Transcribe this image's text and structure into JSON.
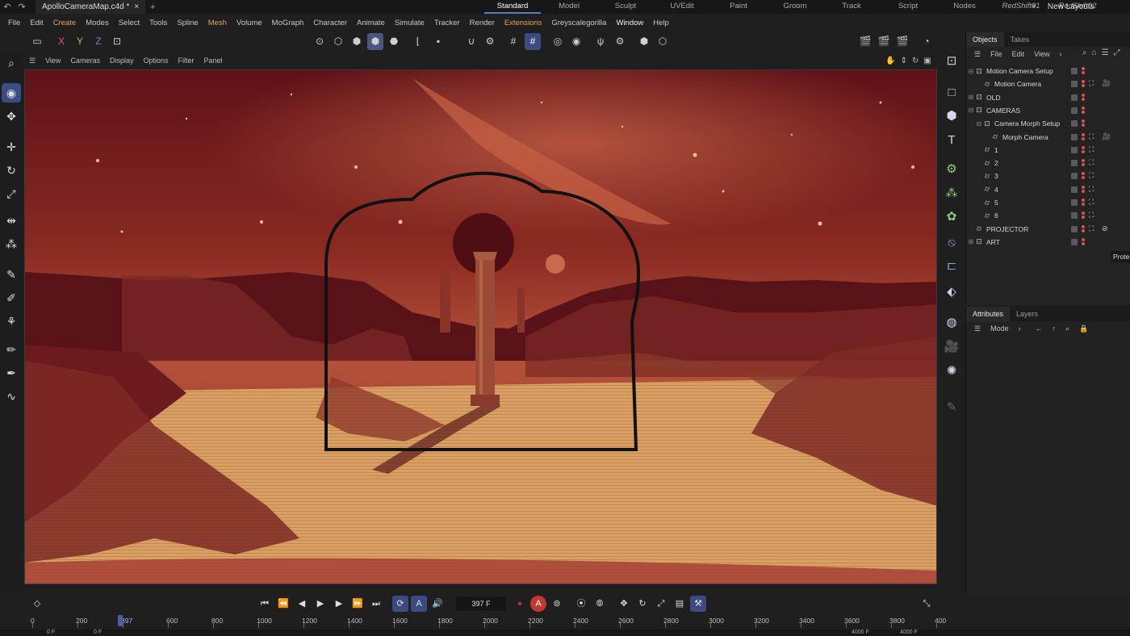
{
  "titlebar": {
    "undo_icon": "undo-icon",
    "redo_icon": "redo-icon",
    "doc_title": "ApolloCameraMap.c4d *",
    "add_tab": "+",
    "layouts": [
      {
        "label": "Standard",
        "active": true,
        "italic": false
      },
      {
        "label": "Model",
        "active": false,
        "italic": false
      },
      {
        "label": "Sculpt",
        "active": false,
        "italic": false
      },
      {
        "label": "UVEdit",
        "active": false,
        "italic": false
      },
      {
        "label": "Paint",
        "active": false,
        "italic": false
      },
      {
        "label": "Groom",
        "active": false,
        "italic": false
      },
      {
        "label": "Track",
        "active": false,
        "italic": false
      },
      {
        "label": "Script",
        "active": false,
        "italic": false
      },
      {
        "label": "Nodes",
        "active": false,
        "italic": false
      },
      {
        "label": "RedShift01",
        "active": false,
        "italic": true
      },
      {
        "label": "RedShift02",
        "active": false,
        "italic": true
      }
    ],
    "new_layout_plus": "+",
    "new_layouts": "New Layouts"
  },
  "menu": [
    "File",
    "Edit",
    "Create",
    "Modes",
    "Select",
    "Tools",
    "Spline",
    "Mesh",
    "Volume",
    "MoGraph",
    "Character",
    "Animate",
    "Simulate",
    "Tracker",
    "Render",
    "Extensions",
    "Greyscalegorilla",
    "Window",
    "Help"
  ],
  "menu_accent": [
    "Create",
    "Mesh",
    "Extensions"
  ],
  "toolbar": {
    "axis_x": "X",
    "axis_y": "Y",
    "axis_z": "Z",
    "colors": {
      "x": "#e0605a",
      "y": "#9ac95a",
      "z": "#5a8ae0"
    }
  },
  "viewport_menu": [
    "View",
    "Cameras",
    "Display",
    "Options",
    "Filter",
    "Panel"
  ],
  "objects_panel": {
    "tabs": [
      "Objects",
      "Takes"
    ],
    "menu": [
      "File",
      "Edit",
      "View"
    ],
    "rows": [
      {
        "label": "Motion Camera Setup",
        "indent": 0,
        "expander": "⊟",
        "icon": "null-icon",
        "tag": "",
        "tag2": ""
      },
      {
        "label": "Motion Camera",
        "indent": 1,
        "expander": "",
        "icon": "camera-icon",
        "tag": "⛶",
        "tag2": "🎥"
      },
      {
        "label": "OLD",
        "indent": 0,
        "expander": "⊞",
        "icon": "null-icon",
        "tag": "",
        "tag2": ""
      },
      {
        "label": "CAMERAS",
        "indent": 0,
        "expander": "⊟",
        "icon": "null-icon",
        "tag": "",
        "tag2": ""
      },
      {
        "label": "Camera Morph Setup",
        "indent": 1,
        "expander": "⊟",
        "icon": "null-icon",
        "tag": "",
        "tag2": ""
      },
      {
        "label": "Morph Camera",
        "indent": 2,
        "expander": "",
        "icon": "camera-icon",
        "tag": "⛶",
        "tag2": "🎥"
      },
      {
        "label": "1",
        "indent": 1,
        "expander": "",
        "icon": "camera-icon",
        "tag": "⛶",
        "tag2": ""
      },
      {
        "label": "2",
        "indent": 1,
        "expander": "",
        "icon": "camera-icon",
        "tag": "⛶",
        "tag2": ""
      },
      {
        "label": "3",
        "indent": 1,
        "expander": "",
        "icon": "camera-icon",
        "tag": "⛶",
        "tag2": ""
      },
      {
        "label": "4",
        "indent": 1,
        "expander": "",
        "icon": "camera-icon",
        "tag": "⛶",
        "tag2": ""
      },
      {
        "label": "5",
        "indent": 1,
        "expander": "",
        "icon": "camera-icon",
        "tag": "⛶",
        "tag2": ""
      },
      {
        "label": "6",
        "indent": 1,
        "expander": "",
        "icon": "camera-icon",
        "tag": "⛶",
        "tag2": ""
      },
      {
        "label": "PROJECTOR",
        "indent": 0,
        "expander": "",
        "icon": "camera-icon",
        "tag": "⛶",
        "tag2": "⊘"
      },
      {
        "label": "ART",
        "indent": 0,
        "expander": "⊞",
        "icon": "null-icon",
        "tag": "",
        "tag2": ""
      }
    ],
    "tooltip": "Prote"
  },
  "attributes_panel": {
    "tabs": [
      "Attributes",
      "Layers"
    ],
    "mode": "Mode"
  },
  "timeline": {
    "current_frame": "397 F",
    "ruler_labels": [
      "0",
      "200",
      "397",
      "600",
      "800",
      "1000",
      "1200",
      "1400",
      "1600",
      "1800",
      "2000",
      "2200",
      "2400",
      "2600",
      "2800",
      "3000",
      "3200",
      "3400",
      "3600",
      "3800",
      "400"
    ],
    "playhead_frame": 397
  },
  "status": {
    "left1": "0 F",
    "left2": "0 F",
    "right1": "4000 F",
    "right2": "4000 F"
  }
}
